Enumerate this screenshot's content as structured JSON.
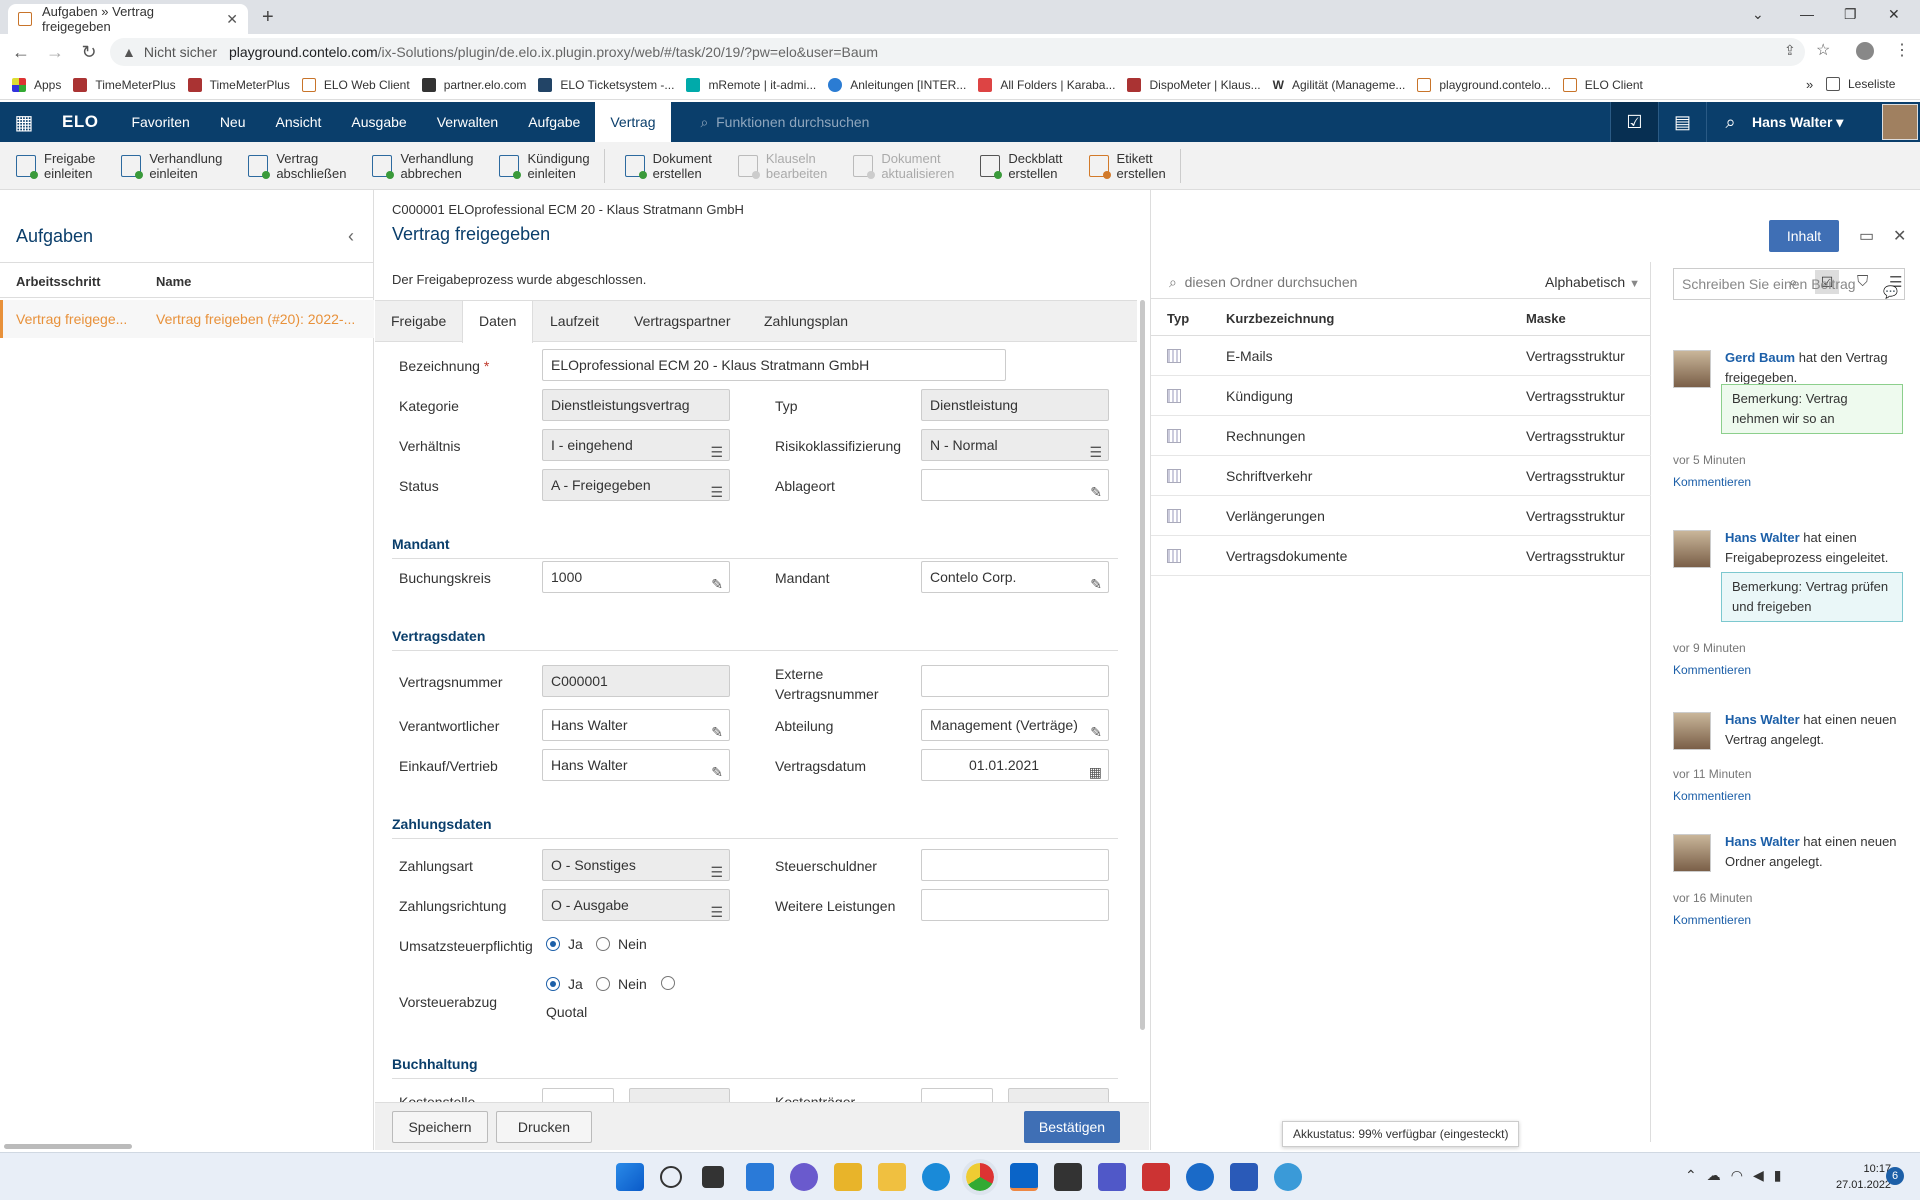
{
  "browser": {
    "tab_title": "Aufgaben » Vertrag freigegeben",
    "security": "Nicht sicher",
    "url_host": "playground.contelo.com",
    "url_path": "/ix-Solutions/plugin/de.elo.ix.plugin.proxy/web/#/task/20/19/?pw=elo&user=Baum",
    "bookmarks": [
      "Apps",
      "TimeMeterPlus",
      "TimeMeterPlus",
      "ELO Web Client",
      "partner.elo.com",
      "ELO Ticketsystem -...",
      "mRemote | it-admi...",
      "Anleitungen [INTER...",
      "All Folders | Karaba...",
      "DispoMeter | Klaus...",
      "Agilität (Manageme...",
      "playground.contelo...",
      "ELO Client"
    ],
    "reading_list": "Leseliste"
  },
  "app": {
    "logo": "ELO",
    "menu": [
      "Favoriten",
      "Neu",
      "Ansicht",
      "Ausgabe",
      "Verwalten",
      "Aufgabe",
      "Vertrag"
    ],
    "active_menu": "Vertrag",
    "search_placeholder": "Funktionen durchsuchen",
    "user": "Hans Walter"
  },
  "ribbon": [
    {
      "l1": "Freigabe",
      "l2": "einleiten",
      "enabled": true
    },
    {
      "l1": "Verhandlung",
      "l2": "einleiten",
      "enabled": true
    },
    {
      "l1": "Vertrag",
      "l2": "abschließen",
      "enabled": true
    },
    {
      "l1": "Verhandlung",
      "l2": "abbrechen",
      "enabled": true
    },
    {
      "l1": "Kündigung",
      "l2": "einleiten",
      "enabled": true
    },
    {
      "l1": "Dokument",
      "l2": "erstellen",
      "enabled": true
    },
    {
      "l1": "Klauseln",
      "l2": "bearbeiten",
      "enabled": false
    },
    {
      "l1": "Dokument",
      "l2": "aktualisieren",
      "enabled": false
    },
    {
      "l1": "Deckblatt",
      "l2": "erstellen",
      "enabled": true
    },
    {
      "l1": "Etikett",
      "l2": "erstellen",
      "enabled": true
    }
  ],
  "tasks": {
    "title": "Aufgaben",
    "col_step": "Arbeitsschritt",
    "col_name": "Name",
    "row_step": "Vertrag freigege...",
    "row_name": "Vertrag freigeben (#20): 2022-..."
  },
  "detail": {
    "breadcrumb": "C000001 ELOprofessional ECM 20 - Klaus Stratmann GmbH",
    "title": "Vertrag freigegeben",
    "message": "Der Freigabeprozess wurde abgeschlossen.",
    "tabs": [
      "Freigabe",
      "Daten",
      "Laufzeit",
      "Vertragspartner",
      "Zahlungsplan"
    ],
    "active_tab": "Daten",
    "fields": {
      "bezeichnung_label": "Bezeichnung",
      "bezeichnung": "ELOprofessional ECM 20 - Klaus Stratmann GmbH",
      "kategorie_label": "Kategorie",
      "kategorie": "Dienstleistungsvertrag",
      "typ_label": "Typ",
      "typ": "Dienstleistung",
      "verhaeltnis_label": "Verhältnis",
      "verhaeltnis": "I - eingehend",
      "risiko_label": "Risikoklassifizierung",
      "risiko": "N - Normal",
      "status_label": "Status",
      "status": "A - Freigegeben",
      "ablageort_label": "Ablageort",
      "ablageort": ""
    },
    "sections": {
      "mandant": "Mandant",
      "vertragsdaten": "Vertragsdaten",
      "zahlungsdaten": "Zahlungsdaten",
      "buchhaltung": "Buchhaltung"
    },
    "mandant": {
      "buchungskreis_label": "Buchungskreis",
      "buchungskreis": "1000",
      "mandant_label": "Mandant",
      "mandant": "Contelo Corp."
    },
    "vertragsdaten": {
      "vertragsnummer_label": "Vertragsnummer",
      "vertragsnummer": "C000001",
      "extern_label_1": "Externe",
      "extern_label_2": "Vertragsnummer",
      "extern": "",
      "verantwortlicher_label": "Verantwortlicher",
      "verantwortlicher": "Hans Walter",
      "abteilung_label": "Abteilung",
      "abteilung": "Management (Verträge)",
      "einkauf_label": "Einkauf/Vertrieb",
      "einkauf": "Hans Walter",
      "datum_label": "Vertragsdatum",
      "datum": "01.01.2021"
    },
    "zahlungsdaten": {
      "zahlungsart_label": "Zahlungsart",
      "zahlungsart": "O - Sonstiges",
      "steuerschuldner_label": "Steuerschuldner",
      "steuerschuldner": "",
      "richtung_label": "Zahlungsrichtung",
      "richtung": "O - Ausgabe",
      "weitere_label": "Weitere Leistungen",
      "weitere": "",
      "ust_label": "Umsatzsteuerpflichtig",
      "vst_label": "Vorsteuerabzug",
      "ja": "Ja",
      "nein": "Nein",
      "quotal": "Quotal"
    },
    "buchhaltung": {
      "kostenstelle_label": "Kostenstelle",
      "kostentraeger_label": "Kostenträger"
    },
    "buttons": {
      "save": "Speichern",
      "print": "Drucken",
      "confirm": "Bestätigen"
    }
  },
  "right": {
    "inhalt_button": "Inhalt",
    "folder_search": "diesen Ordner durchsuchen",
    "sort": "Alphabetisch",
    "columns": [
      "Typ",
      "Kurzbezeichnung",
      "Maske"
    ],
    "rows": [
      {
        "name": "E-Mails",
        "mask": "Vertragsstruktur"
      },
      {
        "name": "Kündigung",
        "mask": "Vertragsstruktur"
      },
      {
        "name": "Rechnungen",
        "mask": "Vertragsstruktur"
      },
      {
        "name": "Schriftverkehr",
        "mask": "Vertragsstruktur"
      },
      {
        "name": "Verlängerungen",
        "mask": "Vertragsstruktur"
      },
      {
        "name": "Vertragsdokumente",
        "mask": "Vertragsstruktur"
      }
    ],
    "feed_placeholder": "Schreiben Sie einen Beitrag",
    "posts": [
      {
        "author": "Gerd Baum",
        "text": "hat den Vertrag freigegeben.",
        "note": "Bemerkung: Vertrag nehmen wir so an",
        "time": "vor 5 Minuten",
        "comment": "Kommentieren"
      },
      {
        "author": "Hans Walter",
        "text": "hat einen Freigabeprozess eingeleitet.",
        "note": "Bemerkung: Vertrag prüfen und freigeben",
        "time": "vor 9 Minuten",
        "comment": "Kommentieren"
      },
      {
        "author": "Hans Walter",
        "text": "hat einen neuen Vertrag angelegt.",
        "note": "",
        "time": "vor 11 Minuten",
        "comment": "Kommentieren"
      },
      {
        "author": "Hans Walter",
        "text": "hat einen neuen Ordner angelegt.",
        "note": "",
        "time": "vor 16 Minuten",
        "comment": "Kommentieren"
      }
    ]
  },
  "tooltip": "Akkustatus: 99% verfügbar (eingesteckt)",
  "taskbar": {
    "time": "10:17",
    "date": "27.01.2022",
    "notifications": "6"
  }
}
